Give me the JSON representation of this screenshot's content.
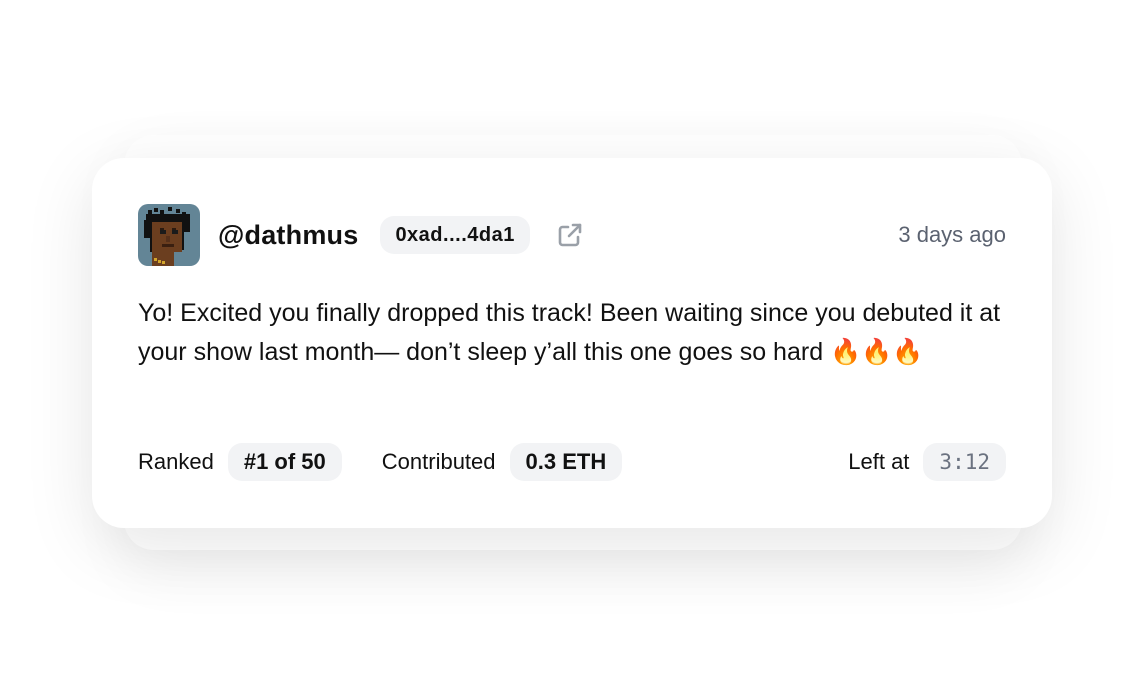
{
  "comment_card": {
    "username": "@dathmus",
    "address": "0xad....4da1",
    "time_ago": "3 days ago",
    "message": "Yo! Excited you finally dropped this track! Been waiting since you debuted it at your show last month— don’t sleep y’all this one goes so hard 🔥🔥🔥",
    "ranked_label": "Ranked",
    "rank_value": "#1 of 50",
    "contributed_label": "Contributed",
    "contributed_value": "0.3 ETH",
    "left_at_label": "Left at",
    "left_at_value": "3:12"
  },
  "icons": {
    "external_link": "external-link-icon",
    "avatar": "pixel-avatar"
  },
  "colors": {
    "pill_background": "#f2f3f5",
    "muted_text": "#5b6270",
    "icon_gray": "#9aa0a8",
    "avatar_background": "#638596"
  }
}
